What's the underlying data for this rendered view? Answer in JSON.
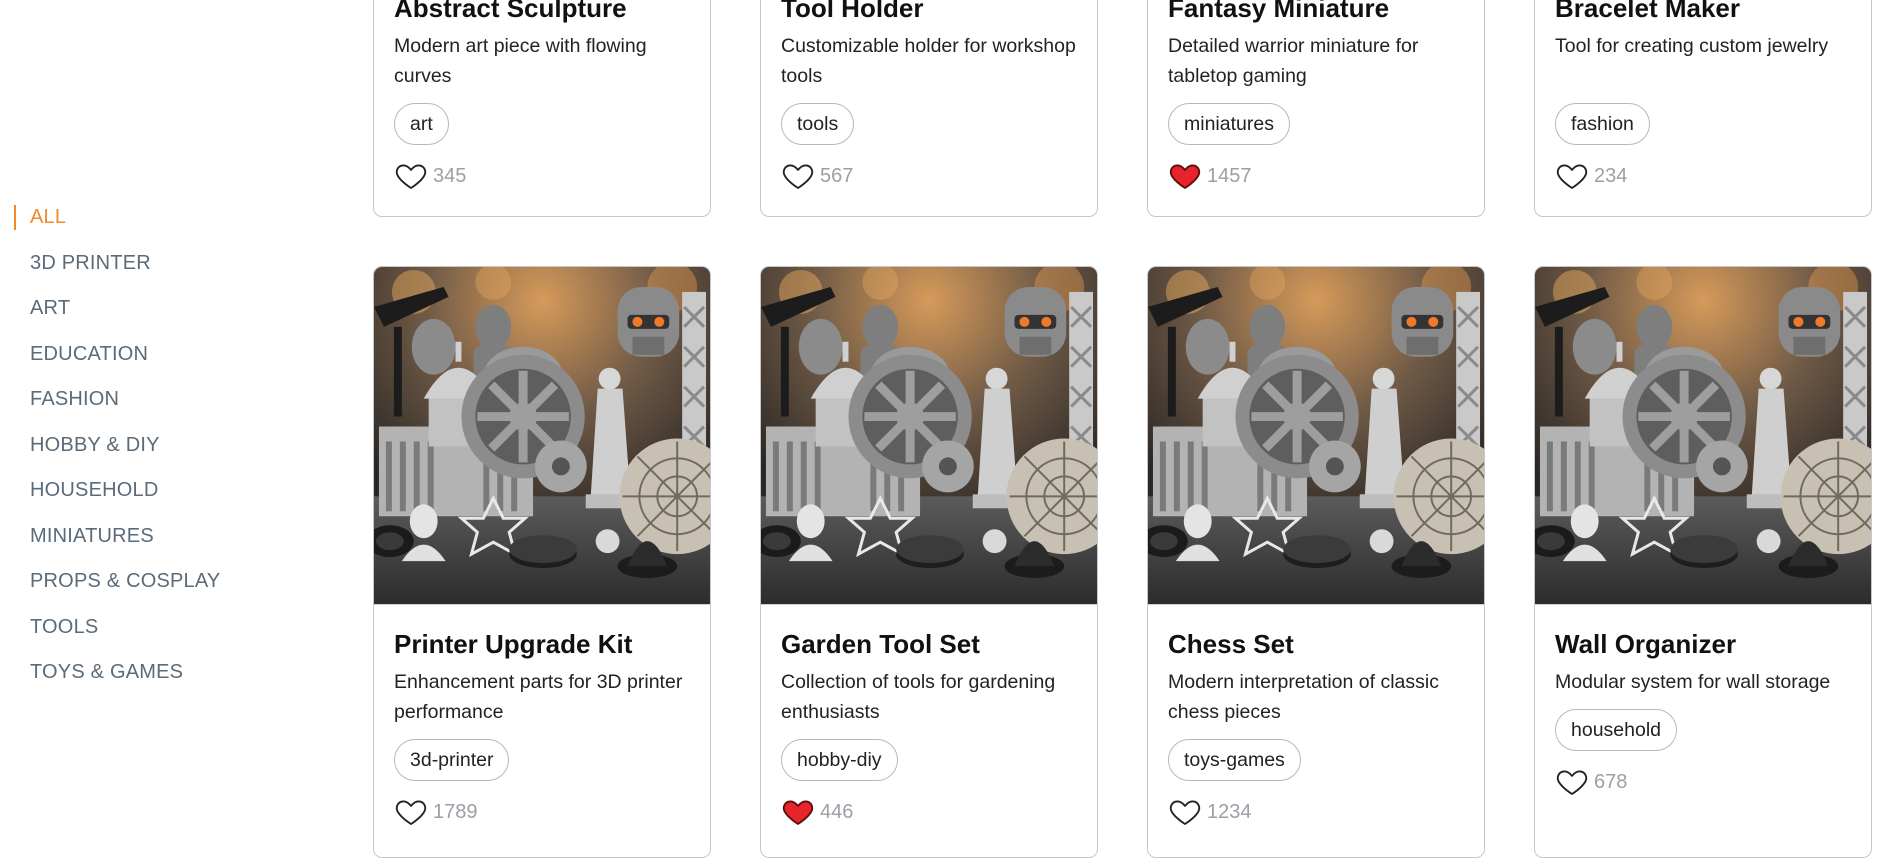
{
  "sidebar": {
    "categories": [
      "ALL",
      "3D PRINTER",
      "ART",
      "EDUCATION",
      "FASHION",
      "HOBBY & DIY",
      "HOUSEHOLD",
      "MINIATURES",
      "PROPS & COSPLAY",
      "TOOLS",
      "TOYS & GAMES"
    ],
    "active": "ALL"
  },
  "colors": {
    "accent": "#ef8a2a",
    "liked": "#e8232a",
    "border": "#c4c7cc"
  },
  "cards_top": [
    {
      "title": "Abstract Sculpture",
      "description": "Modern art piece with flowing curves",
      "tag": "art",
      "likes": "345",
      "liked": false
    },
    {
      "title": "Tool Holder",
      "description": "Customizable holder for workshop tools",
      "tag": "tools",
      "likes": "567",
      "liked": false
    },
    {
      "title": "Fantasy Miniature",
      "description": "Detailed warrior miniature for tabletop gaming",
      "tag": "miniatures",
      "likes": "1457",
      "liked": true
    },
    {
      "title": "Bracelet Maker",
      "description": "Tool for creating custom jewelry",
      "tag": "fashion",
      "likes": "234",
      "liked": false
    }
  ],
  "cards_bottom": [
    {
      "title": "Printer Upgrade Kit",
      "description": "Enhancement parts for 3D printer performance",
      "tag": "3d-printer",
      "likes": "1789",
      "liked": false
    },
    {
      "title": "Garden Tool Set",
      "description": "Collection of tools for gardening enthusiasts",
      "tag": "hobby-diy",
      "likes": "446",
      "liked": true
    },
    {
      "title": "Chess Set",
      "description": "Modern interpretation of classic chess pieces",
      "tag": "toys-games",
      "likes": "1234",
      "liked": false
    },
    {
      "title": "Wall Organizer",
      "description": "Modular system for wall storage",
      "tag": "household",
      "likes": "678",
      "liked": false
    }
  ],
  "icons": {
    "like": "heart-icon",
    "thumbnail": "3d-printed-objects-photo"
  }
}
